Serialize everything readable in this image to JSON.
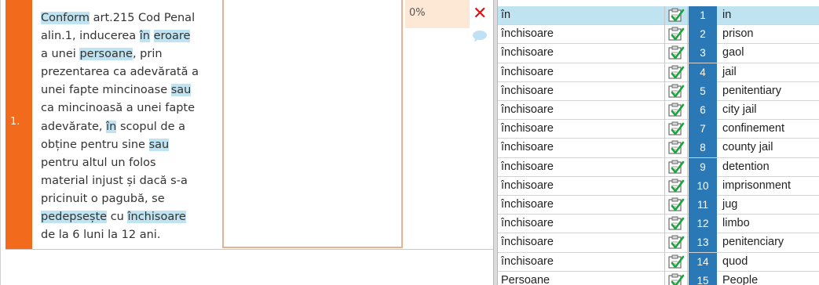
{
  "segment": {
    "number": "1.",
    "source_lines": [
      [
        {
          "t": "Conform",
          "h": true
        },
        {
          "t": " art.215 Cod Penal",
          "h": false
        }
      ],
      [
        {
          "t": "alin.1, inducerea ",
          "h": false
        },
        {
          "t": "în",
          "h": true
        },
        {
          "t": " ",
          "h": false
        },
        {
          "t": "eroare",
          "h": true
        }
      ],
      [
        {
          "t": "a unei ",
          "h": false
        },
        {
          "t": "persoane",
          "h": true
        },
        {
          "t": ", prin",
          "h": false
        }
      ],
      [
        {
          "t": "prezentarea ca adevărată a",
          "h": false
        }
      ],
      [
        {
          "t": "unei fapte mincinoase ",
          "h": false
        },
        {
          "t": "sau",
          "h": true
        }
      ],
      [
        {
          "t": "ca mincinoasă a unei fapte",
          "h": false
        }
      ],
      [
        {
          "t": "adevărate, ",
          "h": false
        },
        {
          "t": "în",
          "h": true
        },
        {
          "t": " scopul de a",
          "h": false
        }
      ],
      [
        {
          "t": "obține pentru sine ",
          "h": false
        },
        {
          "t": "sau",
          "h": true
        }
      ],
      [
        {
          "t": "pentru altul un folos",
          "h": false
        }
      ],
      [
        {
          "t": "material injust și dacă s-a",
          "h": false
        }
      ],
      [
        {
          "t": "pricinuit o pagubă, se",
          "h": false
        }
      ],
      [
        {
          "t": "pedepsește",
          "h": true
        },
        {
          "t": " cu ",
          "h": false
        },
        {
          "t": "închisoare",
          "h": true
        }
      ],
      [
        {
          "t": "de la 6 luni la 12 ani.",
          "h": false
        }
      ]
    ],
    "target_text": "",
    "match_percent": "0%",
    "colors": {
      "number_bar": "#f26a1b",
      "highlight": "#bfe3f1",
      "match_bg": "#fde8d6"
    }
  },
  "icons": {
    "reject": "close-x-icon",
    "comment": "speech-bubble-icon",
    "term_edit": "edit-check-icon"
  },
  "term_list": [
    {
      "source": "în",
      "num": "1",
      "target": "in",
      "selected": true
    },
    {
      "source": "închisoare",
      "num": "2",
      "target": "prison"
    },
    {
      "source": "închisoare",
      "num": "3",
      "target": "gaol"
    },
    {
      "source": "închisoare",
      "num": "4",
      "target": "jail"
    },
    {
      "source": "închisoare",
      "num": "5",
      "target": "penitentiary"
    },
    {
      "source": "închisoare",
      "num": "6",
      "target": "city jail"
    },
    {
      "source": "închisoare",
      "num": "7",
      "target": "confinement"
    },
    {
      "source": "închisoare",
      "num": "8",
      "target": "county jail"
    },
    {
      "source": "închisoare",
      "num": "9",
      "target": "detention"
    },
    {
      "source": "închisoare",
      "num": "10",
      "target": "imprisonment"
    },
    {
      "source": "închisoare",
      "num": "11",
      "target": "jug"
    },
    {
      "source": "închisoare",
      "num": "12",
      "target": "limbo"
    },
    {
      "source": "închisoare",
      "num": "13",
      "target": "penitenciary"
    },
    {
      "source": "închisoare",
      "num": "14",
      "target": "quod"
    },
    {
      "source": "Persoane",
      "num": "15",
      "target": "People"
    }
  ]
}
